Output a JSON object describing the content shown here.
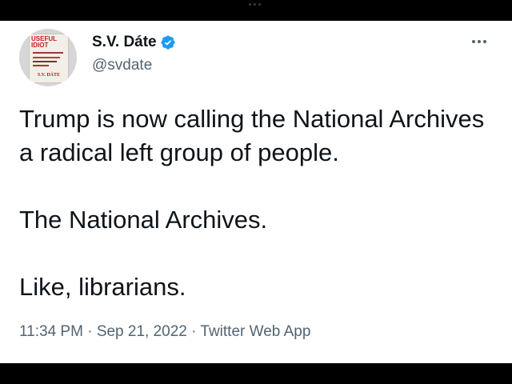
{
  "avatar": {
    "book_title": "USEFUL\nIDIOT",
    "book_author": "S.V. DÁTE"
  },
  "author": {
    "display_name": "S.V. Dáte",
    "handle": "@svdate",
    "verified": true,
    "verified_color": "#1d9bf0"
  },
  "tweet": {
    "paragraphs": [
      "Trump is now calling the National Archives a radical left group of people.",
      "The National Archives.",
      "Like, librarians."
    ]
  },
  "meta": {
    "time": "11:34 PM",
    "separator": "·",
    "date": "Sep 21, 2022",
    "source": "Twitter Web App"
  },
  "colors": {
    "text": "#0f1419",
    "secondary": "#536471",
    "background": "#ffffff",
    "frame": "#000000"
  }
}
